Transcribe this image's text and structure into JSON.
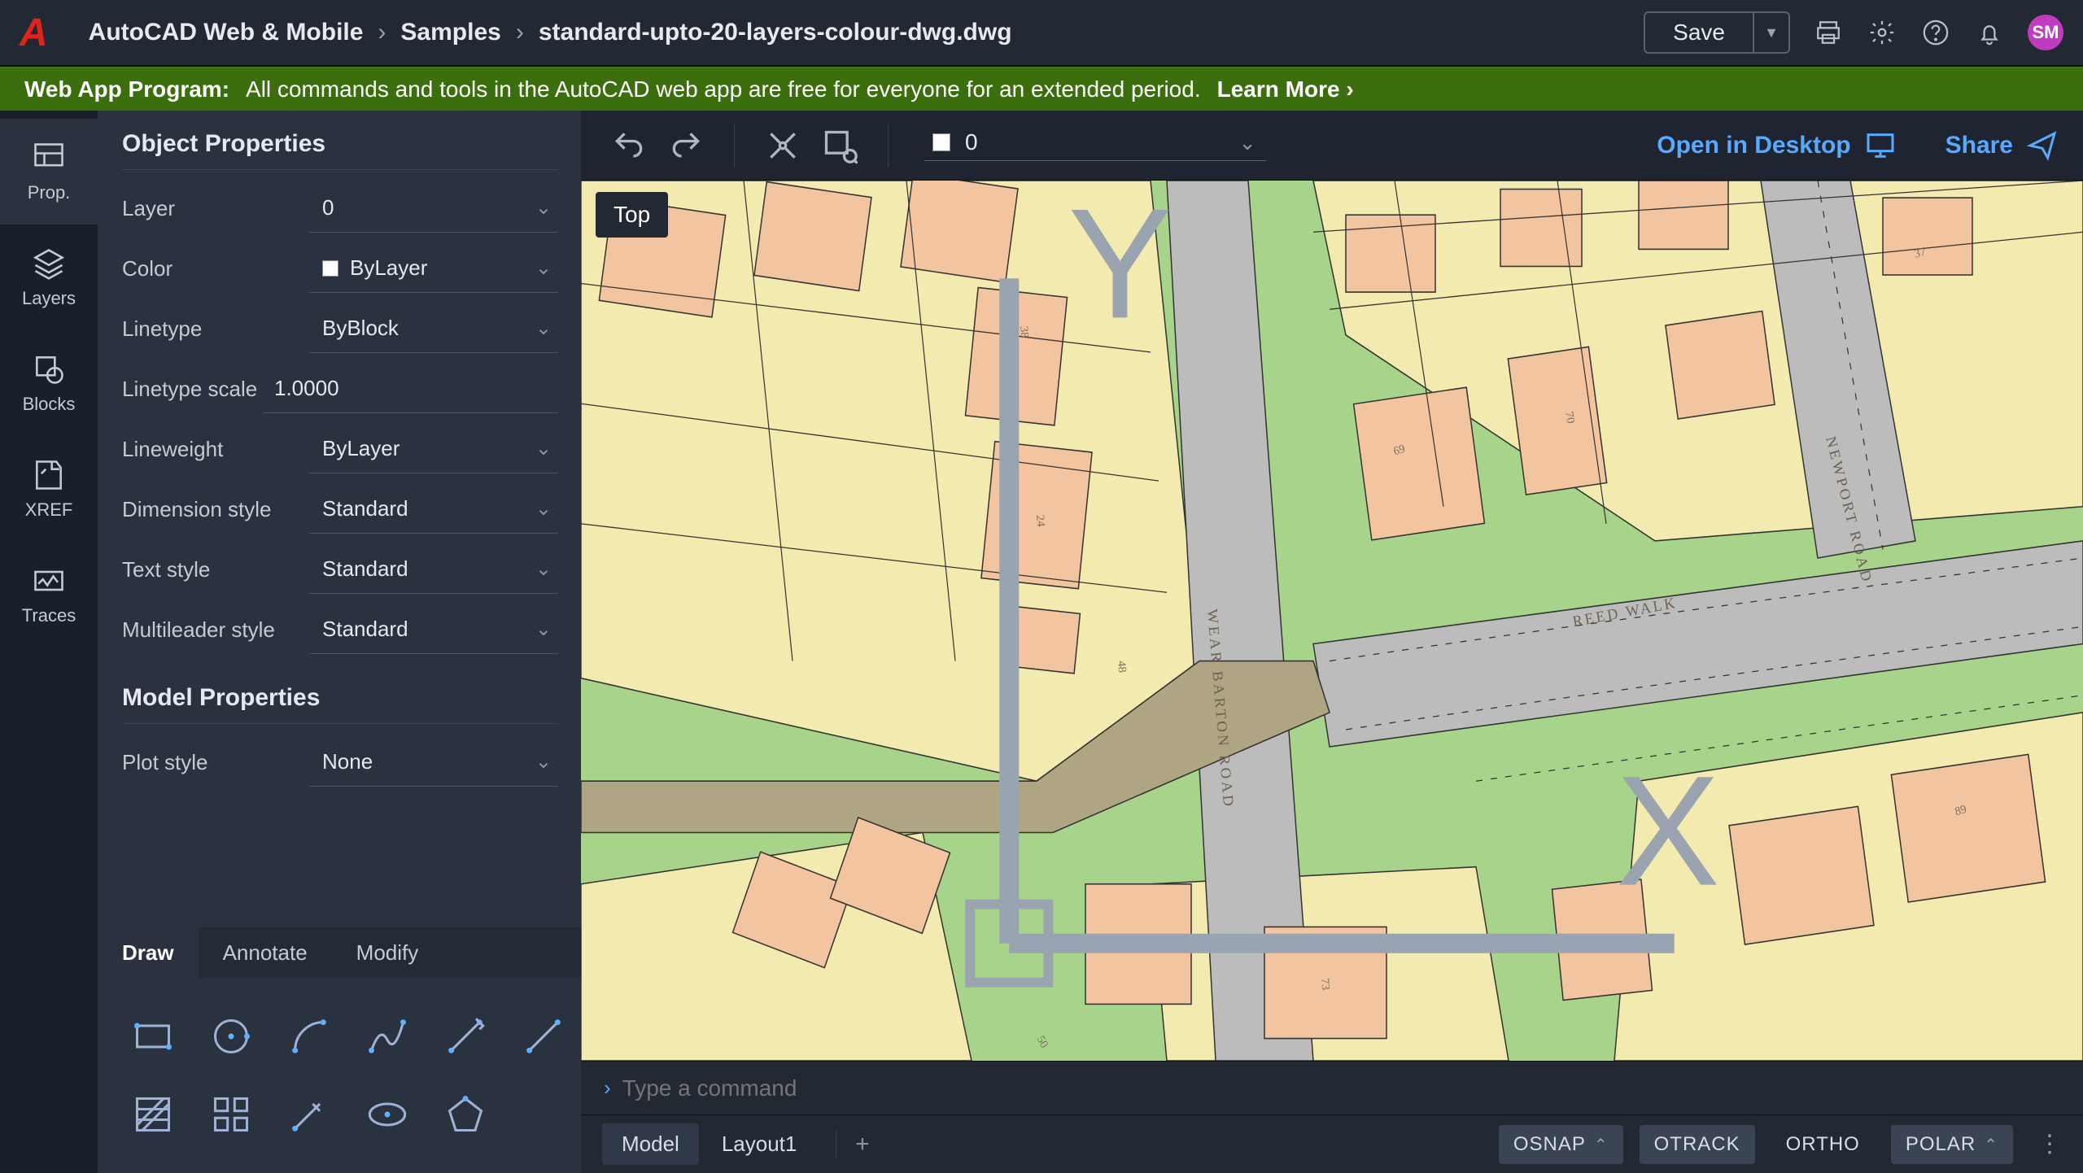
{
  "header": {
    "app_name": "AutoCAD Web & Mobile",
    "breadcrumb": [
      "Samples",
      "standard-upto-20-layers-colour-dwg.dwg"
    ],
    "save_label": "Save",
    "avatar_initials": "SM"
  },
  "banner": {
    "prefix": "Web App Program:",
    "message": "All commands and tools in the AutoCAD web app are free for everyone for an extended period.",
    "learn_more": "Learn More"
  },
  "rail": {
    "items": [
      {
        "key": "prop",
        "label": "Prop."
      },
      {
        "key": "layers",
        "label": "Layers"
      },
      {
        "key": "blocks",
        "label": "Blocks"
      },
      {
        "key": "xref",
        "label": "XREF"
      },
      {
        "key": "traces",
        "label": "Traces"
      }
    ],
    "active": "prop"
  },
  "properties": {
    "object_heading": "Object Properties",
    "model_heading": "Model Properties",
    "rows": {
      "layer": {
        "label": "Layer",
        "value": "0"
      },
      "color": {
        "label": "Color",
        "value": "ByLayer"
      },
      "linetype": {
        "label": "Linetype",
        "value": "ByBlock"
      },
      "ltscale": {
        "label": "Linetype scale",
        "value": "1.0000"
      },
      "lweight": {
        "label": "Lineweight",
        "value": "ByLayer"
      },
      "dimstyle": {
        "label": "Dimension style",
        "value": "Standard"
      },
      "textstyle": {
        "label": "Text style",
        "value": "Standard"
      },
      "mleader": {
        "label": "Multileader style",
        "value": "Standard"
      },
      "plotstyle": {
        "label": "Plot style",
        "value": "None"
      }
    }
  },
  "tool_tabs": {
    "items": [
      "Draw",
      "Annotate",
      "Modify"
    ],
    "active": "Draw"
  },
  "canvas": {
    "layer_swatch_value": "0",
    "open_desktop": "Open in Desktop",
    "share": "Share",
    "view_label": "Top",
    "roads": {
      "wear_barton": "WEAR BARTON ROAD",
      "reed_walk": "REED WALK",
      "newport": "NEWPORT ROAD"
    },
    "plot_numbers": [
      "38",
      "24",
      "48",
      "50",
      "69",
      "70",
      "73",
      "37",
      "89"
    ]
  },
  "command": {
    "placeholder": "Type a command"
  },
  "layouts": {
    "tabs": [
      "Model",
      "Layout1"
    ],
    "active": "Model"
  },
  "status": {
    "osnap": "OSNAP",
    "otrack": "OTRACK",
    "ortho": "ORTHO",
    "polar": "POLAR"
  }
}
